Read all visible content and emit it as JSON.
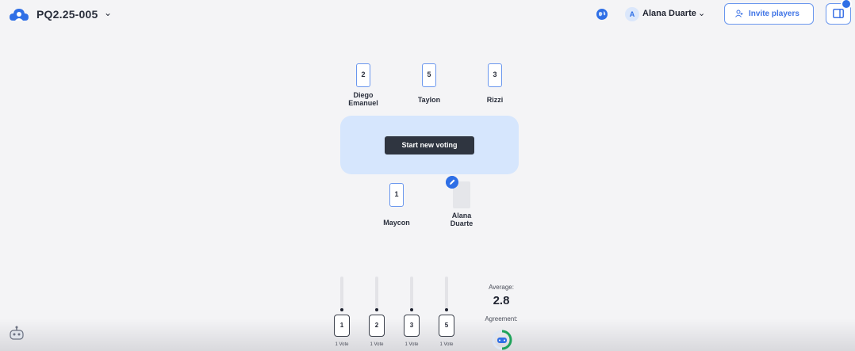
{
  "header": {
    "session_title": "PQ2.25-005",
    "user_initial": "A",
    "user_name": "Alana Duarte",
    "invite_label": "Invite players"
  },
  "players_top": [
    {
      "name": "Diego Emanuel",
      "card": "2"
    },
    {
      "name": "Taylon",
      "card": "5"
    },
    {
      "name": "Rizzi",
      "card": "3"
    }
  ],
  "table": {
    "button_label": "Start new voting"
  },
  "players_bottom": [
    {
      "name": "Maycon",
      "card": "1"
    },
    {
      "name": "Alana Duarte",
      "card": ""
    }
  ],
  "results": {
    "votes": [
      {
        "card": "1",
        "count_label": "1 Vote",
        "share": 0.25
      },
      {
        "card": "2",
        "count_label": "1 Vote",
        "share": 0.25
      },
      {
        "card": "3",
        "count_label": "1 Vote",
        "share": 0.25
      },
      {
        "card": "5",
        "count_label": "1 Vote",
        "share": 0.25
      }
    ],
    "average_label": "Average:",
    "average_value": "2.8",
    "agreement_label": "Agreement:"
  },
  "icons": {
    "logo": "cloud-person-icon",
    "globe": "globe-icon",
    "invite": "person-plus-icon",
    "sidebar": "sidebar-toggle-icon",
    "edit": "pencil-icon",
    "robot": "robot-icon"
  },
  "colors": {
    "accent": "#2f6fe6",
    "table": "#d6e6fd",
    "button_dark": "#2f3540",
    "agreement_ring": "#1fa35a"
  }
}
